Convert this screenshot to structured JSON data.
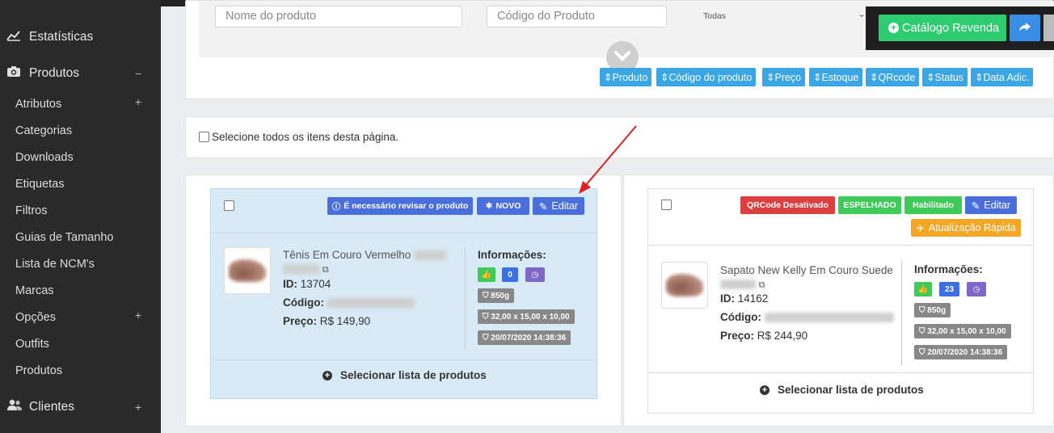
{
  "sidebar": {
    "main_items": [
      {
        "label": "Estatísticas",
        "icon": "chart-line-icon"
      },
      {
        "label": "Produtos",
        "icon": "camera-icon",
        "toggle": "−"
      },
      {
        "label": "Clientes",
        "icon": "users-icon",
        "toggle": "+"
      }
    ],
    "sub_items": [
      {
        "label": "Atributos",
        "toggle": "+"
      },
      {
        "label": "Categorias"
      },
      {
        "label": "Downloads"
      },
      {
        "label": "Etiquetas"
      },
      {
        "label": "Filtros"
      },
      {
        "label": "Guias de Tamanho"
      },
      {
        "label": "Lista de NCM's"
      },
      {
        "label": "Marcas"
      },
      {
        "label": "Opções",
        "toggle": "+"
      },
      {
        "label": "Outfits"
      },
      {
        "label": "Produtos"
      }
    ]
  },
  "filters": {
    "name_placeholder": "Nome do produto",
    "code_placeholder": "Código do Produto",
    "status_select": "Todas"
  },
  "sort_tags": [
    "Produto",
    "Código do produto",
    "Preço",
    "Estoque",
    "QRcode",
    "Status",
    "Data Adic."
  ],
  "toolbar": {
    "catalog_label": "Catálogo Revenda",
    "share_icon": "share-icon"
  },
  "select_all_label": "Selecione todos os itens desta página.",
  "products": [
    {
      "badges": [
        "É necessário revisar o produto",
        "NOVO",
        "Editar"
      ],
      "name": "Tênis Em Couro Vermelho",
      "id_label": "ID:",
      "id": "13704",
      "code_label": "Código:",
      "price_label": "Preço:",
      "price": "R$ 149,90",
      "info_title": "Informações:",
      "counter": "0",
      "weight": "850g",
      "dimensions": "32,00 x 15,00 x 10,00",
      "date": "20/07/2020 14:38:36",
      "select_list": "Selecionar lista de produtos"
    },
    {
      "badges": [
        "QRCode Desativado",
        "ESPELHADO",
        "Habilitado",
        "Editar",
        "Atualização Rápida"
      ],
      "name": "Sapato New Kelly Em Couro Suede",
      "id_label": "ID:",
      "id": "14162",
      "code_label": "Código:",
      "price_label": "Preço:",
      "price": "R$ 244,90",
      "info_title": "Informações:",
      "counter": "23",
      "weight": "850g",
      "dimensions": "32,00 x 15,00 x 10,00",
      "date": "20/07/2020 14:38:36",
      "select_list": "Selecionar lista de produtos"
    }
  ],
  "colors": {
    "sidebar_bg": "#2a2a2a",
    "accent_blue": "#3aa6e6",
    "green": "#2ecc71",
    "highlight_card": "#d8eaf5",
    "annotation_arrow": "#e02020"
  }
}
